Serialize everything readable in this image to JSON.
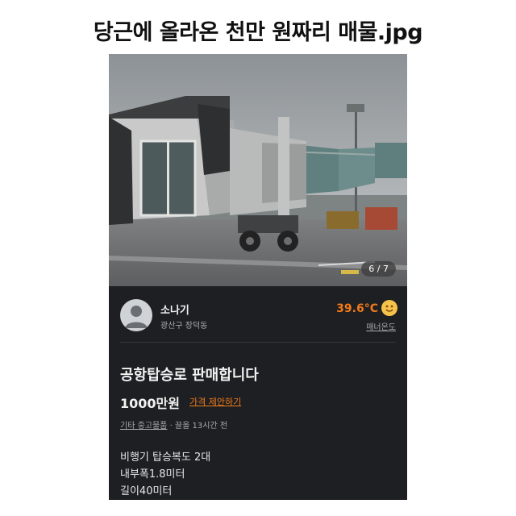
{
  "page": {
    "title": "당근에 올라온 천만 원짜리 매물.jpg"
  },
  "listing": {
    "photo": {
      "counter": "6 / 7"
    },
    "seller": {
      "name": "소나기",
      "location": "광산구 장덕동",
      "temperature": "39.6°C",
      "temperature_label": "매너온도",
      "temperature_icon": "smile-face-icon"
    },
    "title": "공항탑승로 판매합니다",
    "price": "1000만원",
    "price_offer": "가격 제안하기",
    "category": "기타 중고물품",
    "time_info": "· 끌올 13시간 전",
    "description": [
      "비행기 탑승복도 2대",
      "내부폭1.8미터",
      "길이40미터"
    ]
  },
  "colors": {
    "accent": "#f07a1a",
    "screen_bg": "#1e1f22",
    "text_primary": "#f2f2f2",
    "text_secondary": "#a9abaf"
  }
}
